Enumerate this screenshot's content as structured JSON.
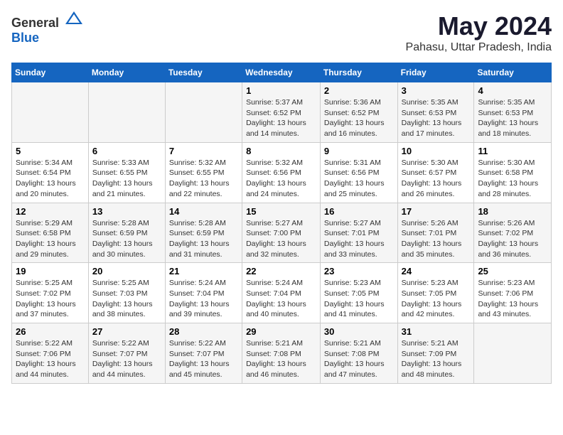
{
  "logo": {
    "general": "General",
    "blue": "Blue"
  },
  "title": "May 2024",
  "subtitle": "Pahasu, Uttar Pradesh, India",
  "days_of_week": [
    "Sunday",
    "Monday",
    "Tuesday",
    "Wednesday",
    "Thursday",
    "Friday",
    "Saturday"
  ],
  "weeks": [
    [
      {
        "day": "",
        "content": ""
      },
      {
        "day": "",
        "content": ""
      },
      {
        "day": "",
        "content": ""
      },
      {
        "day": "1",
        "content": "Sunrise: 5:37 AM\nSunset: 6:52 PM\nDaylight: 13 hours and 14 minutes."
      },
      {
        "day": "2",
        "content": "Sunrise: 5:36 AM\nSunset: 6:52 PM\nDaylight: 13 hours and 16 minutes."
      },
      {
        "day": "3",
        "content": "Sunrise: 5:35 AM\nSunset: 6:53 PM\nDaylight: 13 hours and 17 minutes."
      },
      {
        "day": "4",
        "content": "Sunrise: 5:35 AM\nSunset: 6:53 PM\nDaylight: 13 hours and 18 minutes."
      }
    ],
    [
      {
        "day": "5",
        "content": "Sunrise: 5:34 AM\nSunset: 6:54 PM\nDaylight: 13 hours and 20 minutes."
      },
      {
        "day": "6",
        "content": "Sunrise: 5:33 AM\nSunset: 6:55 PM\nDaylight: 13 hours and 21 minutes."
      },
      {
        "day": "7",
        "content": "Sunrise: 5:32 AM\nSunset: 6:55 PM\nDaylight: 13 hours and 22 minutes."
      },
      {
        "day": "8",
        "content": "Sunrise: 5:32 AM\nSunset: 6:56 PM\nDaylight: 13 hours and 24 minutes."
      },
      {
        "day": "9",
        "content": "Sunrise: 5:31 AM\nSunset: 6:56 PM\nDaylight: 13 hours and 25 minutes."
      },
      {
        "day": "10",
        "content": "Sunrise: 5:30 AM\nSunset: 6:57 PM\nDaylight: 13 hours and 26 minutes."
      },
      {
        "day": "11",
        "content": "Sunrise: 5:30 AM\nSunset: 6:58 PM\nDaylight: 13 hours and 28 minutes."
      }
    ],
    [
      {
        "day": "12",
        "content": "Sunrise: 5:29 AM\nSunset: 6:58 PM\nDaylight: 13 hours and 29 minutes."
      },
      {
        "day": "13",
        "content": "Sunrise: 5:28 AM\nSunset: 6:59 PM\nDaylight: 13 hours and 30 minutes."
      },
      {
        "day": "14",
        "content": "Sunrise: 5:28 AM\nSunset: 6:59 PM\nDaylight: 13 hours and 31 minutes."
      },
      {
        "day": "15",
        "content": "Sunrise: 5:27 AM\nSunset: 7:00 PM\nDaylight: 13 hours and 32 minutes."
      },
      {
        "day": "16",
        "content": "Sunrise: 5:27 AM\nSunset: 7:01 PM\nDaylight: 13 hours and 33 minutes."
      },
      {
        "day": "17",
        "content": "Sunrise: 5:26 AM\nSunset: 7:01 PM\nDaylight: 13 hours and 35 minutes."
      },
      {
        "day": "18",
        "content": "Sunrise: 5:26 AM\nSunset: 7:02 PM\nDaylight: 13 hours and 36 minutes."
      }
    ],
    [
      {
        "day": "19",
        "content": "Sunrise: 5:25 AM\nSunset: 7:02 PM\nDaylight: 13 hours and 37 minutes."
      },
      {
        "day": "20",
        "content": "Sunrise: 5:25 AM\nSunset: 7:03 PM\nDaylight: 13 hours and 38 minutes."
      },
      {
        "day": "21",
        "content": "Sunrise: 5:24 AM\nSunset: 7:04 PM\nDaylight: 13 hours and 39 minutes."
      },
      {
        "day": "22",
        "content": "Sunrise: 5:24 AM\nSunset: 7:04 PM\nDaylight: 13 hours and 40 minutes."
      },
      {
        "day": "23",
        "content": "Sunrise: 5:23 AM\nSunset: 7:05 PM\nDaylight: 13 hours and 41 minutes."
      },
      {
        "day": "24",
        "content": "Sunrise: 5:23 AM\nSunset: 7:05 PM\nDaylight: 13 hours and 42 minutes."
      },
      {
        "day": "25",
        "content": "Sunrise: 5:23 AM\nSunset: 7:06 PM\nDaylight: 13 hours and 43 minutes."
      }
    ],
    [
      {
        "day": "26",
        "content": "Sunrise: 5:22 AM\nSunset: 7:06 PM\nDaylight: 13 hours and 44 minutes."
      },
      {
        "day": "27",
        "content": "Sunrise: 5:22 AM\nSunset: 7:07 PM\nDaylight: 13 hours and 44 minutes."
      },
      {
        "day": "28",
        "content": "Sunrise: 5:22 AM\nSunset: 7:07 PM\nDaylight: 13 hours and 45 minutes."
      },
      {
        "day": "29",
        "content": "Sunrise: 5:21 AM\nSunset: 7:08 PM\nDaylight: 13 hours and 46 minutes."
      },
      {
        "day": "30",
        "content": "Sunrise: 5:21 AM\nSunset: 7:08 PM\nDaylight: 13 hours and 47 minutes."
      },
      {
        "day": "31",
        "content": "Sunrise: 5:21 AM\nSunset: 7:09 PM\nDaylight: 13 hours and 48 minutes."
      },
      {
        "day": "",
        "content": ""
      }
    ]
  ]
}
